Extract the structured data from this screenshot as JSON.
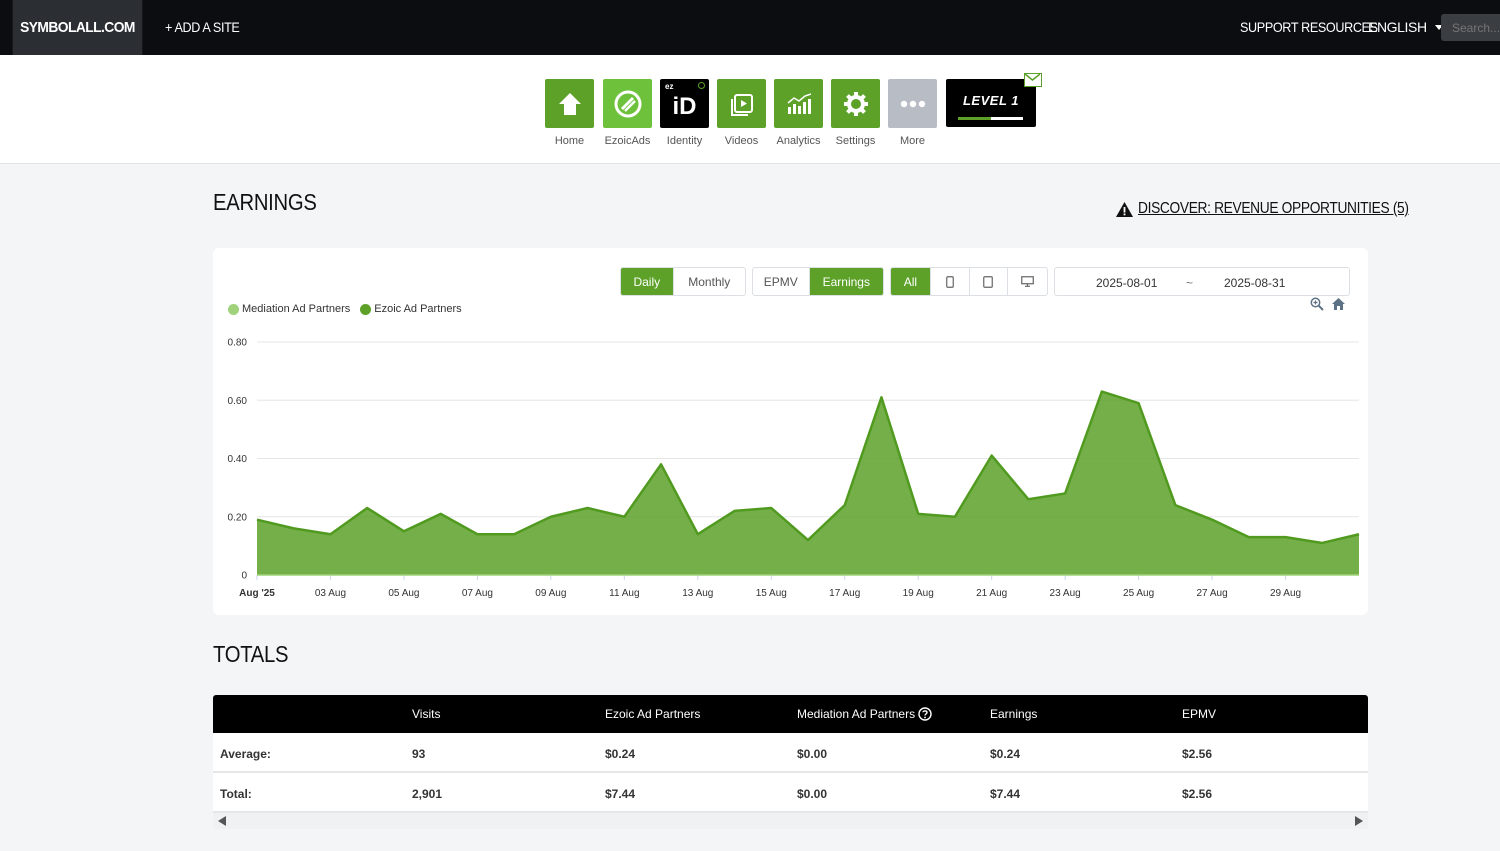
{
  "topnav": {
    "brand": "SYMBOLALL.COM",
    "add_site": "+ ADD A SITE",
    "support": "SUPPORT RESOURCES",
    "language": "ENGLISH",
    "search_placeholder": "Search..."
  },
  "apps": [
    {
      "label": "Home",
      "icon": "home-icon"
    },
    {
      "label": "EzoicAds",
      "icon": "ezoic-ads-icon"
    },
    {
      "label": "Identity",
      "icon": "identity-id-icon",
      "tile_text": "iD",
      "tile_sub": "ez"
    },
    {
      "label": "Videos",
      "icon": "video-play-icon"
    },
    {
      "label": "Analytics",
      "icon": "analytics-chart-icon"
    },
    {
      "label": "Settings",
      "icon": "gear-icon"
    },
    {
      "label": "More",
      "icon": "more-dots-icon"
    }
  ],
  "level": {
    "label": "LEVEL 1",
    "progress": 0.5
  },
  "earnings": {
    "title": "EARNINGS",
    "discover": "DISCOVER: REVENUE OPPORTUNITIES (5)"
  },
  "controls": {
    "period": [
      "Daily",
      "Monthly"
    ],
    "period_active": "Daily",
    "metric": [
      "EPMV",
      "Earnings"
    ],
    "metric_active": "Earnings",
    "device_all": "All",
    "date_start": "2025-08-01",
    "date_sep": "~",
    "date_end": "2025-08-31"
  },
  "colors": {
    "accent": "#5da129",
    "mediation": "#9fd27a",
    "ezoic": "#5da129"
  },
  "chart_data": {
    "type": "area",
    "legend": [
      "Mediation Ad Partners",
      "Ezoic Ad Partners"
    ],
    "x_tick_labels": [
      "Aug '25",
      "03 Aug",
      "05 Aug",
      "07 Aug",
      "09 Aug",
      "11 Aug",
      "13 Aug",
      "15 Aug",
      "17 Aug",
      "19 Aug",
      "21 Aug",
      "23 Aug",
      "25 Aug",
      "27 Aug",
      "29 Aug"
    ],
    "y_tick_labels": [
      "0",
      "0.20",
      "0.40",
      "0.60",
      "0.80"
    ],
    "ylim": [
      0,
      0.8
    ],
    "x": [
      "2025-08-01",
      "2025-08-02",
      "2025-08-03",
      "2025-08-04",
      "2025-08-05",
      "2025-08-06",
      "2025-08-07",
      "2025-08-08",
      "2025-08-09",
      "2025-08-10",
      "2025-08-11",
      "2025-08-12",
      "2025-08-13",
      "2025-08-14",
      "2025-08-15",
      "2025-08-16",
      "2025-08-17",
      "2025-08-18",
      "2025-08-19",
      "2025-08-20",
      "2025-08-21",
      "2025-08-22",
      "2025-08-23",
      "2025-08-24",
      "2025-08-25",
      "2025-08-26",
      "2025-08-27",
      "2025-08-28",
      "2025-08-29",
      "2025-08-30",
      "2025-08-31"
    ],
    "series": [
      {
        "name": "Mediation Ad Partners",
        "values": [
          0,
          0,
          0,
          0,
          0,
          0,
          0,
          0,
          0,
          0,
          0,
          0,
          0,
          0,
          0,
          0,
          0,
          0,
          0,
          0,
          0,
          0,
          0,
          0,
          0,
          0,
          0,
          0,
          0,
          0,
          0
        ]
      },
      {
        "name": "Ezoic Ad Partners",
        "values": [
          0.19,
          0.16,
          0.14,
          0.23,
          0.15,
          0.21,
          0.14,
          0.14,
          0.2,
          0.23,
          0.2,
          0.38,
          0.14,
          0.22,
          0.23,
          0.12,
          0.24,
          0.61,
          0.21,
          0.2,
          0.41,
          0.26,
          0.28,
          0.63,
          0.59,
          0.24,
          0.19,
          0.13,
          0.13,
          0.11,
          0.14
        ]
      }
    ],
    "grid": true
  },
  "totals": {
    "title": "TOTALS",
    "columns": [
      "",
      "Visits",
      "Ezoic Ad Partners",
      "Mediation Ad Partners",
      "Earnings",
      "EPMV"
    ],
    "rows": [
      [
        "Average:",
        "93",
        "$0.24",
        "$0.00",
        "$0.24",
        "$2.56"
      ],
      [
        "Total:",
        "2,901",
        "$7.44",
        "$0.00",
        "$7.44",
        "$2.56"
      ]
    ]
  }
}
